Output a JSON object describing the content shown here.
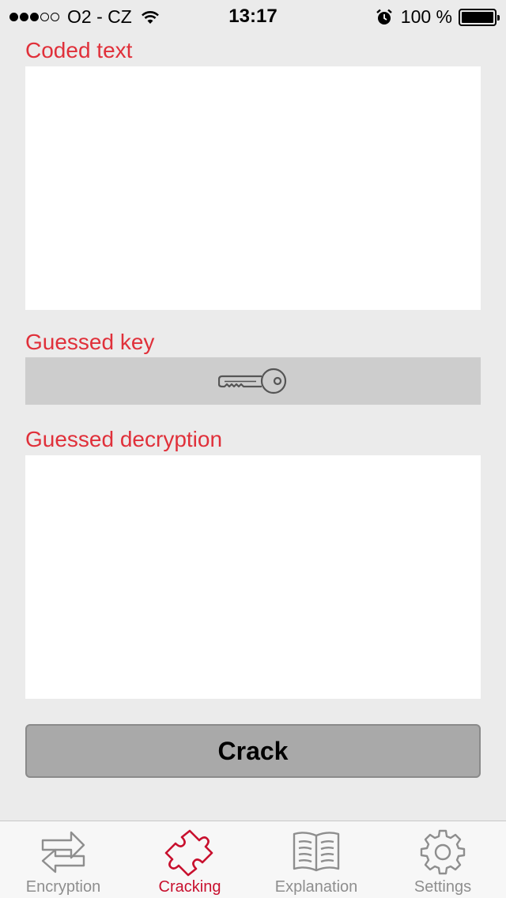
{
  "status_bar": {
    "carrier": "O2 - CZ",
    "time": "13:17",
    "battery": "100 %"
  },
  "main": {
    "coded_text_label": "Coded text",
    "guessed_key_label": "Guessed key",
    "guessed_decryption_label": "Guessed decryption",
    "crack_button": "Crack"
  },
  "tabs": [
    {
      "label": "Encryption",
      "icon": "swap-arrows-icon",
      "active": false
    },
    {
      "label": "Cracking",
      "icon": "puzzle-icon",
      "active": true
    },
    {
      "label": "Explanation",
      "icon": "book-icon",
      "active": false
    },
    {
      "label": "Settings",
      "icon": "gear-icon",
      "active": false
    }
  ],
  "colors": {
    "accent": "#e0303a",
    "active_tab": "#c8102e",
    "inactive_tab": "#8e8e8e",
    "background": "#ebebeb"
  }
}
